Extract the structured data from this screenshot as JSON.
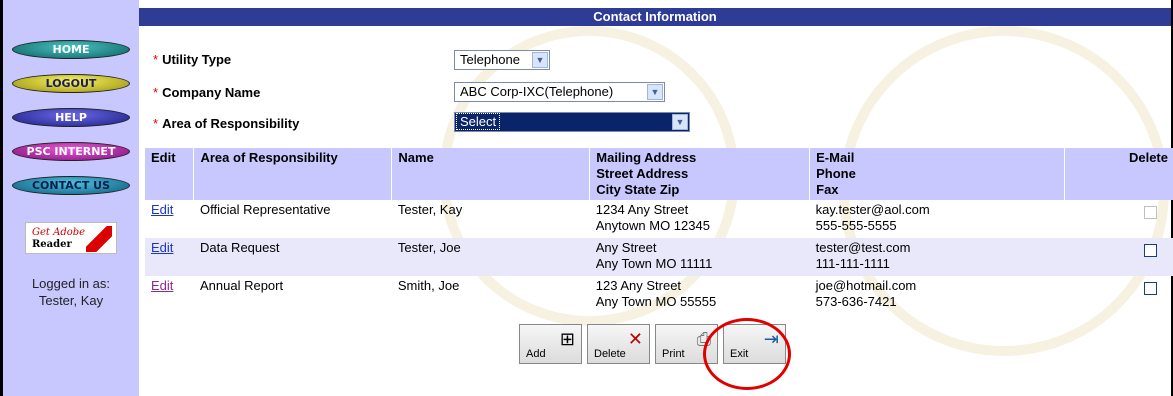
{
  "title": "Contact Information",
  "nav": {
    "home": "HOME",
    "logout": "LOGOUT",
    "help": "HELP",
    "psc_internet": "PSC INTERNET",
    "contact_us": "CONTACT US"
  },
  "adobe": {
    "get": "Get Adobe",
    "reader": "Reader"
  },
  "logged_in": {
    "label": "Logged in as:",
    "user": "Tester, Kay"
  },
  "form": {
    "utility_type": {
      "label": "Utility Type",
      "value": "Telephone"
    },
    "company_name": {
      "label": "Company Name",
      "value": "ABC Corp-IXC(Telephone)"
    },
    "area": {
      "label": "Area of Responsibility",
      "value": "Select"
    }
  },
  "table": {
    "headers": {
      "edit": "Edit",
      "area": "Area of Responsibility",
      "name": "Name",
      "addr1": "Mailing Address",
      "addr2": "Street Address",
      "addr3": "City State Zip",
      "contact1": "E-Mail",
      "contact2": "Phone",
      "contact3": "Fax",
      "delete": "Delete"
    },
    "rows": [
      {
        "edit": "Edit",
        "area": "Official Representative",
        "name": "Tester, Kay",
        "street": "1234 Any Street",
        "city": "Anytown MO 12345",
        "email": "kay.tester@aol.com",
        "phone": "555-555-5555"
      },
      {
        "edit": "Edit",
        "area": "Data Request",
        "name": "Tester, Joe",
        "street": "Any Street",
        "city": "Any Town MO 11111",
        "email": "tester@test.com",
        "phone": "111-111-1111"
      },
      {
        "edit": "Edit",
        "area": "Annual Report",
        "name": "Smith, Joe",
        "street": "123 Any Street",
        "city": "Any Town MO 55555",
        "email": "joe@hotmail.com",
        "phone": "573-636-7421"
      }
    ]
  },
  "buttons": {
    "add": "Add",
    "delete": "Delete",
    "print": "Print",
    "exit": "Exit"
  },
  "colors": {
    "title_bar": "#2e3c96",
    "sidebar": "#c8c8ff",
    "header_row": "#c8c8ff",
    "highlight_circle": "#e00000"
  }
}
